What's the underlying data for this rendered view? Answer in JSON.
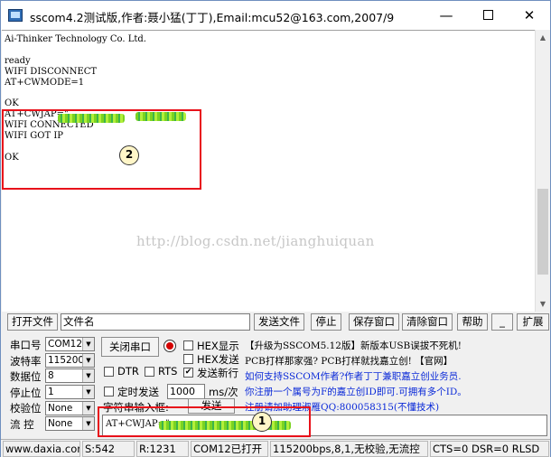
{
  "window": {
    "title": "sscom4.2测试版,作者:聂小猛(丁丁),Email:mcu52@163.com,2007/9",
    "minimize_glyph": "—",
    "close_glyph": "✕"
  },
  "terminal": {
    "lines": [
      "Ai-Thinker Technology Co. Ltd.",
      "",
      "ready",
      "WIFI DISCONNECT",
      "AT+CWMODE=1",
      "",
      "OK",
      "AT+CWJAP=\"",
      "WIFI CONNECTED",
      "WIFI GOT IP",
      "",
      "OK"
    ],
    "watermark": "http://blog.csdn.net/jianghuiquan",
    "annotation_2": "2",
    "scrollbar_up_glyph": "▲",
    "scrollbar_down_glyph": "▼"
  },
  "file_row": {
    "open_file_button": "打开文件",
    "filename_field": "文件名",
    "send_file_button": "发送文件",
    "stop_button": "停止",
    "save_window_button": "保存窗口",
    "clear_window_button": "清除窗口",
    "help_button": "帮助",
    "dash_button": "_",
    "expand_button": "扩展"
  },
  "settings": {
    "port_label": "串口号",
    "port_value": "COM12",
    "baud_label": "波特率",
    "baud_value": "115200",
    "databits_label": "数据位",
    "databits_value": "8",
    "stopbits_label": "停止位",
    "stopbits_value": "1",
    "parity_label": "校验位",
    "parity_value": "None",
    "flow_label": "流  控",
    "flow_value": "None",
    "close_port_button": "关闭串口",
    "hex_display": "HEX显示",
    "hex_send": "HEX发送",
    "dtr": "DTR",
    "rts": "RTS",
    "send_newline": "发送新行",
    "send_newline_checked": "✔",
    "timed_send": "定时发送",
    "interval_value": "1000",
    "interval_unit": "ms/次",
    "input_box_label": "字符串输入框:",
    "send_button": "发送"
  },
  "info": {
    "line1": "【升级为SSCOM5.12版】新版本USB误拔不死机!",
    "line2": "PCB打样那家强? PCB打样就找嘉立创! 【官网】",
    "line3": "如何支持SSCOM作者?作者丁丁兼职嘉立创业务员.",
    "line4": "你注册一个属号为F的嘉立创ID即可.可拥有多个ID。",
    "line5": "注册请加助理淑雁QQ:800058315(不懂技术)",
    "line1_color": "#000000",
    "line2_color": "#000000",
    "line3_color": "#0b2ad8",
    "line4_color": "#0b2ad8",
    "line5_color": "#0b2ad8"
  },
  "send_input": {
    "value": "AT+CWJAP=\"",
    "annotation_1": "1"
  },
  "statusbar": {
    "website": "www.daxia.com",
    "sent": "S:542",
    "received": "R:1231",
    "port_status": "COM12已打开",
    "port_params": "115200bps,8,1,无校验,无流控",
    "line_status": "CTS=0 DSR=0 RLSD"
  }
}
